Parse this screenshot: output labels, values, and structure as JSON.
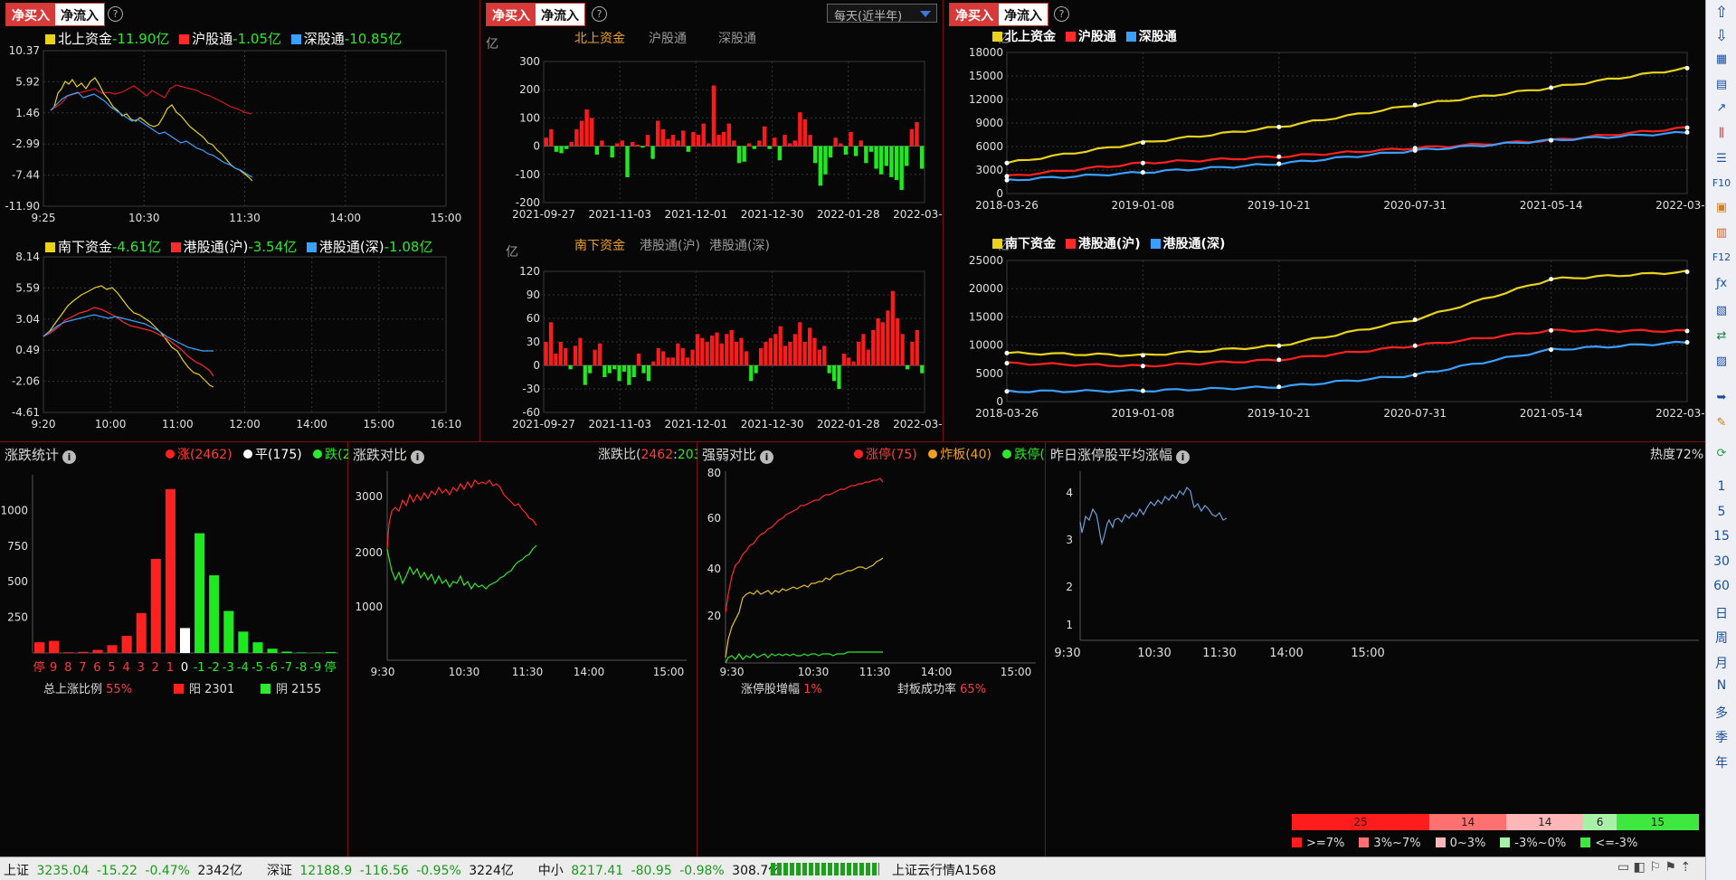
{
  "toggle": {
    "buy": "净买入",
    "flow": "净流入"
  },
  "help_char": "?",
  "p1": {
    "chart_top": {
      "legend": [
        {
          "name": "北上资金",
          "value": "-11.90亿",
          "color": "#e8d21b"
        },
        {
          "name": "沪股通",
          "value": "-1.05亿",
          "color": "#ff2a2a"
        },
        {
          "name": "深股通",
          "value": "-10.85亿",
          "color": "#3aa0ff"
        }
      ],
      "y_ticks": [
        "10.37",
        "5.92",
        "1.46",
        "-2.99",
        "-7.44",
        "-11.90"
      ],
      "x_ticks": [
        "9:25",
        "10:30",
        "11:30",
        "14:00",
        "15:00"
      ]
    },
    "chart_bottom": {
      "legend": [
        {
          "name": "南下资金",
          "value": "-4.61亿",
          "color": "#e8d21b"
        },
        {
          "name": "港股通(沪)",
          "value": "-3.54亿",
          "color": "#ff2a2a"
        },
        {
          "name": "港股通(深)",
          "value": "-1.08亿",
          "color": "#3aa0ff"
        }
      ],
      "y_ticks": [
        "8.14",
        "5.59",
        "3.04",
        "0.49",
        "-2.06",
        "-4.61"
      ],
      "x_ticks": [
        "9:20",
        "10:00",
        "11:00",
        "12:00",
        "14:00",
        "15:00",
        "16:10"
      ]
    }
  },
  "p2": {
    "period": "每天(近半年)",
    "unit": "亿",
    "tabs_top": [
      "北上资金",
      "沪股通",
      "深股通"
    ],
    "tabs_bottom": [
      "南下资金",
      "港股通(沪)",
      "港股通(深)"
    ],
    "y_ticks_top": [
      "300",
      "200",
      "100",
      "0",
      "-100",
      "-200"
    ],
    "y_ticks_bottom": [
      "120",
      "90",
      "60",
      "30",
      "0",
      "-30",
      "-60"
    ],
    "x_ticks": [
      "2021-09-27",
      "2021-11-03",
      "2021-12-01",
      "2021-12-30",
      "2022-01-28",
      "2022-03-04"
    ]
  },
  "p3": {
    "unit": "亿",
    "legend_top": [
      {
        "name": "北上资金",
        "color": "#e8d21b"
      },
      {
        "name": "沪股通",
        "color": "#ff2a2a"
      },
      {
        "name": "深股通",
        "color": "#3aa0ff"
      }
    ],
    "legend_bottom": [
      {
        "name": "南下资金",
        "color": "#e8d21b"
      },
      {
        "name": "港股通(沪)",
        "color": "#ff2a2a"
      },
      {
        "name": "港股通(深)",
        "color": "#3aa0ff"
      }
    ],
    "y_ticks_top": [
      "18000",
      "15000",
      "12000",
      "9000",
      "6000",
      "3000",
      "0"
    ],
    "y_ticks_bottom": [
      "25000",
      "20000",
      "15000",
      "10000",
      "5000",
      "0"
    ],
    "x_ticks": [
      "2018-03-26",
      "2019-01-08",
      "2019-10-21",
      "2020-07-31",
      "2021-05-14",
      "2022-03-24"
    ]
  },
  "b1": {
    "title": "涨跌统计",
    "up_label": "涨",
    "up_count": "2462",
    "flat_label": "平",
    "flat_count": "175",
    "down_label": "跌",
    "down_count": "2030",
    "y_ticks": [
      "1000",
      "750",
      "500",
      "250"
    ],
    "x_labels": [
      "停",
      "9",
      "8",
      "7",
      "6",
      "5",
      "4",
      "3",
      "2",
      "1",
      "0",
      "-1",
      "-2",
      "-3",
      "-4",
      "-5",
      "-6",
      "-7",
      "-8",
      "-9",
      "停"
    ],
    "footer_label": "总上涨比例",
    "footer_pct": "55%",
    "yang": "阳 2301",
    "yin": "阴 2155"
  },
  "b2": {
    "title": "涨跌对比",
    "ratio_label": "涨跌比",
    "ratio_up": "2462",
    "ratio_down": "2030",
    "y_ticks": [
      "3000",
      "2000",
      "1000"
    ],
    "x_ticks": [
      "9:30",
      "10:30",
      "11:30",
      "14:00",
      "15:00"
    ]
  },
  "b3": {
    "title": "强弱对比",
    "limit_up": "涨停(75)",
    "bomb": "炸板(40)",
    "limit_down": "跌停(7)",
    "y_ticks": [
      "80",
      "60",
      "40",
      "20"
    ],
    "x_ticks": [
      "9:30",
      "10:30",
      "11:30",
      "14:00",
      "15:00"
    ],
    "footer1_label": "涨停股增幅",
    "footer1_pct": "1%",
    "footer2_label": "封板成功率",
    "footer2_pct": "65%"
  },
  "b4": {
    "title": "昨日涨停股平均涨幅",
    "heat": "热度72%",
    "y_ticks": [
      "4",
      "3",
      "2",
      "1"
    ],
    "x_ticks": [
      "9:30",
      "10:30",
      "11:30",
      "14:00",
      "15:00"
    ],
    "dist": [
      "25",
      "14",
      "14",
      "6",
      "15"
    ],
    "dist_legend": [
      ">=7%",
      "3%~7%",
      "0~3%",
      "-3%~0%",
      "<=-3%"
    ],
    "dist_colors": [
      "#ff1c1c",
      "#ff7070",
      "#ffb6b6",
      "#a8f0a8",
      "#3ee83e"
    ]
  },
  "toolbar": [
    "1",
    "5",
    "15",
    "30",
    "60",
    "日",
    "周",
    "月",
    "N",
    "多",
    "季",
    "年"
  ],
  "status": {
    "sh_label": "上证",
    "sh_val": "3235.04",
    "sh_chg": "-15.22",
    "sh_pct": "-0.47%",
    "sh_amt": "2342亿",
    "sz_label": "深证",
    "sz_val": "12188.9",
    "sz_chg": "-116.56",
    "sz_pct": "-0.95%",
    "sz_amt": "3224亿",
    "zx_label": "中小",
    "zx_val": "8217.41",
    "zx_chg": "-80.95",
    "zx_pct": "-0.98%",
    "zx_amt": "308.7亿",
    "cloud": "上证云行情A1568"
  },
  "chart_data": [
    {
      "type": "line",
      "title": "北上资金",
      "x": [
        "9:25",
        "10:30",
        "11:30",
        "14:00",
        "15:00"
      ],
      "ylim": [
        -11.9,
        10.37
      ],
      "series": [
        {
          "name": "北上资金",
          "end": -11.9
        },
        {
          "name": "沪股通",
          "end": -1.05
        },
        {
          "name": "深股通",
          "end": -10.85
        }
      ]
    },
    {
      "type": "line",
      "title": "南下资金",
      "x": [
        "9:20",
        "10:00",
        "11:00",
        "12:00",
        "14:00",
        "15:00",
        "16:10"
      ],
      "ylim": [
        -4.61,
        8.14
      ],
      "series": [
        {
          "name": "南下资金",
          "end": -4.61
        },
        {
          "name": "港股通(沪)",
          "end": -3.54
        },
        {
          "name": "港股通(深)",
          "end": -1.08
        }
      ]
    },
    {
      "type": "bar",
      "title": "北上资金",
      "ylim": [
        -200,
        300
      ],
      "x_range": [
        "2021-09-27",
        "2022-03-24"
      ]
    },
    {
      "type": "bar",
      "title": "南下资金",
      "ylim": [
        -60,
        120
      ],
      "x_range": [
        "2021-09-27",
        "2022-03-24"
      ]
    },
    {
      "type": "line",
      "title": "北上资金 累计",
      "x": [
        "2018-03-26",
        "2019-01-08",
        "2019-10-21",
        "2020-07-31",
        "2021-05-14",
        "2022-03-24"
      ],
      "ylim": [
        0,
        18000
      ],
      "series": [
        {
          "name": "北上资金",
          "values": [
            3900,
            6500,
            8500,
            11300,
            13500,
            16000
          ]
        },
        {
          "name": "沪股通",
          "values": [
            2200,
            3900,
            4700,
            5800,
            6800,
            8400
          ]
        },
        {
          "name": "深股通",
          "values": [
            1700,
            2700,
            3800,
            5500,
            6800,
            7800
          ]
        }
      ]
    },
    {
      "type": "line",
      "title": "南下资金 累计",
      "x": [
        "2018-03-26",
        "2019-01-08",
        "2019-10-21",
        "2020-07-31",
        "2021-05-14",
        "2022-03-24"
      ],
      "ylim": [
        0,
        25000
      ],
      "series": [
        {
          "name": "南下资金",
          "values": [
            8600,
            8200,
            9900,
            14500,
            21700,
            23000
          ]
        },
        {
          "name": "港股通(沪)",
          "values": [
            6800,
            6300,
            7400,
            9900,
            12600,
            12500
          ]
        },
        {
          "name": "港股通(深)",
          "values": [
            1800,
            1900,
            2600,
            4700,
            9200,
            10500
          ]
        }
      ]
    },
    {
      "type": "bar",
      "title": "涨跌统计",
      "categories": [
        "停",
        "9",
        "8",
        "7",
        "6",
        "5",
        "4",
        "3",
        "2",
        "1",
        "0",
        "-1",
        "-2",
        "-3",
        "-4",
        "-5",
        "-6",
        "-7",
        "-8",
        "-9",
        "停"
      ],
      "values": [
        75,
        85,
        5,
        8,
        22,
        55,
        120,
        280,
        660,
        1150,
        175,
        840,
        545,
        295,
        150,
        75,
        30,
        10,
        4,
        2,
        7
      ],
      "ylim": [
        0,
        1250
      ]
    },
    {
      "type": "line",
      "title": "涨跌对比",
      "ylim": [
        0,
        3500
      ],
      "series": [
        {
          "name": "涨",
          "end": 2462
        },
        {
          "name": "跌",
          "end": 2030
        }
      ]
    },
    {
      "type": "line",
      "title": "强弱对比",
      "ylim": [
        0,
        80
      ],
      "series": [
        {
          "name": "涨停",
          "end": 75
        },
        {
          "name": "炸板",
          "end": 40
        },
        {
          "name": "跌停",
          "end": 7
        }
      ]
    },
    {
      "type": "line",
      "title": "昨日涨停股平均涨幅",
      "ylim": [
        0,
        4.5
      ]
    }
  ]
}
